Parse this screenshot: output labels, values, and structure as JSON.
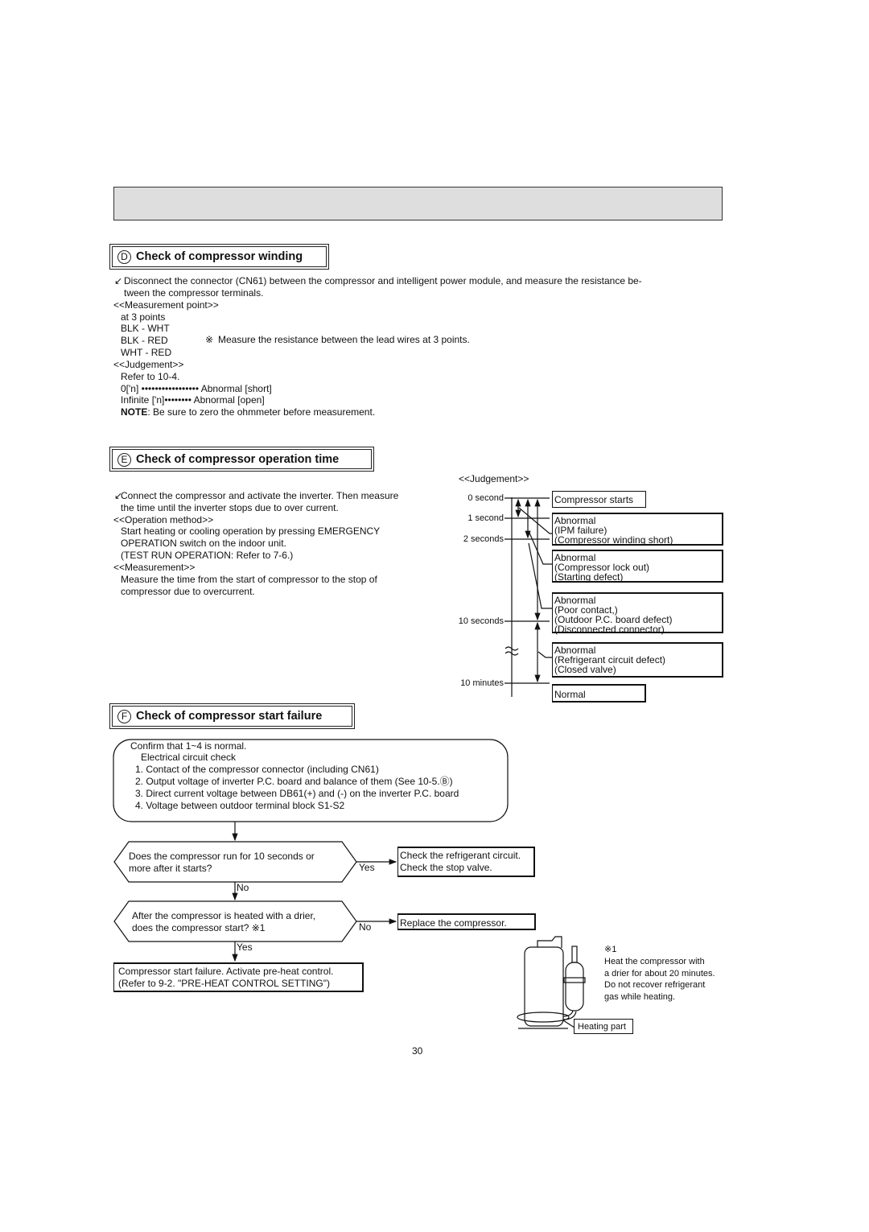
{
  "section_d": {
    "badge": "D",
    "title": "Check of compressor winding",
    "intro_line1": "Disconnect the connector (CN61) between the compressor and intelligent power module, and measure the resistance be-",
    "intro_line2": "tween the compressor terminals.",
    "measurement_point_label": "<<Measurement point>>",
    "points_label": "at 3 points",
    "pairs": [
      "BLK - WHT",
      "BLK - RED",
      "WHT - RED"
    ],
    "note_mark": "Measure the resistance between the lead wires at 3 points.",
    "judgement_label": "<<Judgement>>",
    "refer": "Refer to 10-4.",
    "short_line": "0['n] ••••••••••••••••• Abnormal [short]",
    "open_line": "Infinite ['n]•••••••• Abnormal [open]",
    "note_bold": "NOTE",
    "note_text": ": Be sure to zero the ohmmeter before measurement."
  },
  "section_e": {
    "badge": "E",
    "title": "Check of compressor operation time",
    "intro_line1": "Connect the compressor and activate the inverter. Then measure",
    "intro_line2": "the time until the inverter stops due to over current.",
    "method_label": "<<Operation method>>",
    "method_line1": "Start heating or cooling operation by pressing EMERGENCY",
    "method_line2": "OPERATION switch on the indoor unit.",
    "method_line3": "(TEST RUN OPERATION: Refer to 7-6.)",
    "measurement_label": "<<Measurement>>",
    "measurement_line1": "Measure the time from the start of compressor to the stop of",
    "measurement_line2": "compressor due to overcurrent.",
    "judgement_label": "<<Judgement>>",
    "ticks": [
      "0 second",
      "1 second",
      "2 seconds",
      "10 seconds",
      "10 minutes"
    ],
    "boxes": [
      [
        "Compressor starts"
      ],
      [
        "Abnormal",
        "(IPM failure)",
        "(Compressor winding short)"
      ],
      [
        "Abnormal",
        "(Compressor lock out)",
        "(Starting defect)"
      ],
      [
        "Abnormal",
        "(Poor contact,)",
        "(Outdoor P.C. board defect)",
        "(Disconnected connector)"
      ],
      [
        "Abnormal",
        "(Refrigerant circuit defect)",
        "(Closed valve)"
      ],
      [
        "Normal"
      ]
    ]
  },
  "section_f": {
    "badge": "F",
    "title": "Check of compressor start failure",
    "check_box": [
      "Confirm that 1~4 is normal.",
      "Electrical circuit check",
      "1. Contact of the compressor connector (including CN61)",
      "2. Output voltage of inverter P.C. board and balance of them (See 10-5.Ⓑ)",
      "3. Direct current voltage between DB61(+) and (-) on the inverter P.C. board",
      "4. Voltage between outdoor terminal block S1-S2"
    ],
    "q1": [
      "Does the compressor run for 10 seconds or",
      "more after it starts?"
    ],
    "q1_yes": "Yes",
    "q1_yes_result": [
      "Check the refrigerant circuit.",
      "Check the stop valve."
    ],
    "q1_no": "No",
    "q2": [
      "After the compressor is heated with a drier,",
      "does the compressor start? ※1"
    ],
    "q2_no": "No",
    "q2_no_result": "Replace the compressor.",
    "q2_yes": "Yes",
    "final": [
      "Compressor start failure. Activate pre-heat control.",
      "(Refer to 9-2. \"PRE-HEAT CONTROL SETTING\")"
    ],
    "footnote_mark": "※1",
    "footnote": [
      "Heat the compressor with",
      "a drier for about 20 minutes.",
      "Do not recover refrigerant",
      "gas while heating."
    ],
    "heating_label": "Heating part"
  },
  "page_number": "30"
}
